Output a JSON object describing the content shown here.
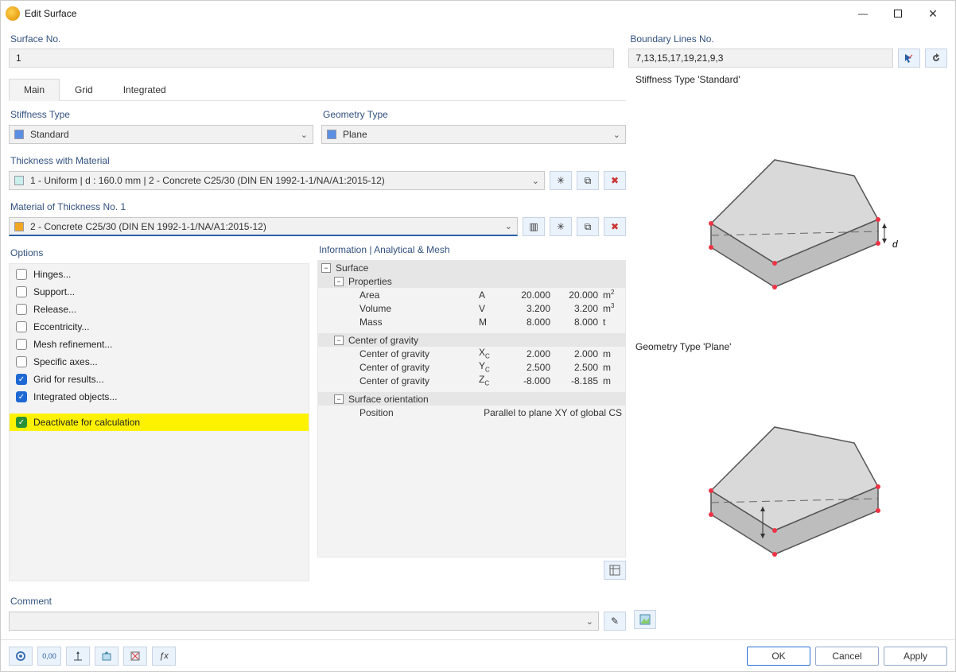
{
  "title": "Edit Surface",
  "surface_no": {
    "label": "Surface No.",
    "value": "1"
  },
  "boundary": {
    "label": "Boundary Lines No.",
    "value": "7,13,15,17,19,21,9,3"
  },
  "tabs": {
    "main": "Main",
    "grid": "Grid",
    "integrated": "Integrated"
  },
  "stiffness": {
    "label": "Stiffness Type",
    "value": "Standard"
  },
  "geometry": {
    "label": "Geometry Type",
    "value": "Plane"
  },
  "thickness": {
    "label": "Thickness with Material",
    "value": "1 - Uniform | d : 160.0 mm | 2 - Concrete C25/30 (DIN EN 1992-1-1/NA/A1:2015-12)"
  },
  "material": {
    "label": "Material of Thickness No. 1",
    "value": "2 - Concrete C25/30 (DIN EN 1992-1-1/NA/A1:2015-12)"
  },
  "options": {
    "label": "Options",
    "items": [
      {
        "label": "Hinges...",
        "checked": false
      },
      {
        "label": "Support...",
        "checked": false
      },
      {
        "label": "Release...",
        "checked": false
      },
      {
        "label": "Eccentricity...",
        "checked": false
      },
      {
        "label": "Mesh refinement...",
        "checked": false
      },
      {
        "label": "Specific axes...",
        "checked": false
      },
      {
        "label": "Grid for results...",
        "checked": true
      },
      {
        "label": "Integrated objects...",
        "checked": true
      },
      {
        "label": "Deactivate for calculation",
        "checked": true,
        "highlight": true
      }
    ]
  },
  "info": {
    "label": "Information | Analytical & Mesh",
    "surface": "Surface",
    "properties": "Properties",
    "area": {
      "label": "Area",
      "sym": "A",
      "v1": "20.000",
      "v2": "20.000",
      "unit": "m²"
    },
    "volume": {
      "label": "Volume",
      "sym": "V",
      "v1": "3.200",
      "v2": "3.200",
      "unit": "m³"
    },
    "mass": {
      "label": "Mass",
      "sym": "M",
      "v1": "8.000",
      "v2": "8.000",
      "unit": "t"
    },
    "cog": "Center of gravity",
    "xc": {
      "label": "Center of gravity",
      "sym": "Xc",
      "v1": "2.000",
      "v2": "2.000",
      "unit": "m"
    },
    "yc": {
      "label": "Center of gravity",
      "sym": "Yc",
      "v1": "2.500",
      "v2": "2.500",
      "unit": "m"
    },
    "zc": {
      "label": "Center of gravity",
      "sym": "Zc",
      "v1": "-8.000",
      "v2": "-8.185",
      "unit": "m"
    },
    "surf_orient": "Surface orientation",
    "position_label": "Position",
    "position_value": "Parallel to plane XY of global CS"
  },
  "comment": {
    "label": "Comment"
  },
  "preview": {
    "stiffness_caption": "Stiffness Type 'Standard'",
    "geometry_caption": "Geometry Type 'Plane'"
  },
  "buttons": {
    "ok": "OK",
    "cancel": "Cancel",
    "apply": "Apply"
  },
  "icons": {
    "pointer": "pointer-icon",
    "revert": "revert-icon",
    "lib": "library-icon",
    "new": "new-icon",
    "copy": "copy-icon",
    "delete": "delete-icon",
    "table": "table-icon",
    "help": "help-icon",
    "units": "units-icon",
    "axes": "axes-icon",
    "export": "export-icon",
    "del2": "delete2-icon",
    "fx": "function-icon",
    "img": "image-icon"
  }
}
